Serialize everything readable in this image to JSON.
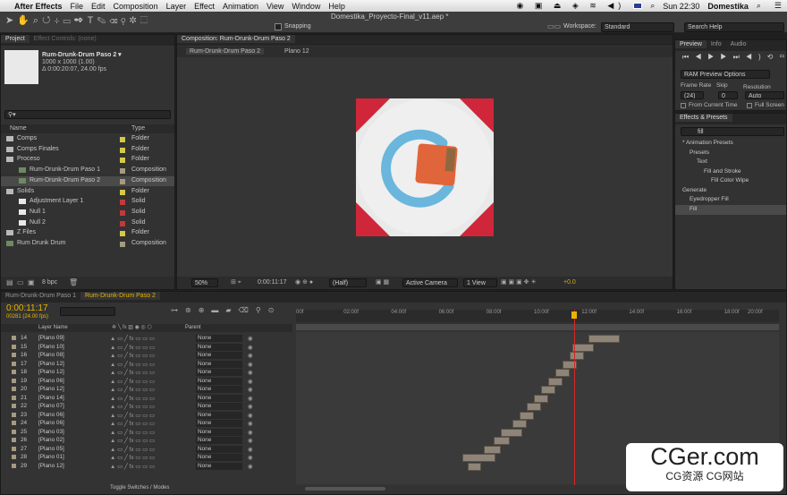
{
  "menubar": {
    "app": "After Effects",
    "items": [
      "File",
      "Edit",
      "Composition",
      "Layer",
      "Effect",
      "Animation",
      "View",
      "Window",
      "Help"
    ],
    "lang": "U.S.",
    "clock": "Sun 22:30",
    "user": "Domestika"
  },
  "window": {
    "title": "Domestika_Proyecto-Final_v11.aep *"
  },
  "toolbar": {
    "snapping": "Snapping",
    "workspace_label": "Workspace:",
    "workspace": "Standard",
    "search": "Search Help"
  },
  "project": {
    "tab": "Project",
    "tab2": "Effect Controls: (none)",
    "comp_name": "Rum-Drunk-Drum Paso 2 ▾",
    "comp_size": "1000 x 1000 (1.00)",
    "comp_dur": "Δ 0:00:20:07, 24.00 fps",
    "search": "⚲▾",
    "col_name": "Name",
    "col_type": "Type",
    "bpc": "8 bpc",
    "items": [
      {
        "name": "Comps",
        "type": "Folder",
        "color": "#d6c94a",
        "indent": 0,
        "kind": "folder"
      },
      {
        "name": "Comps Finales",
        "type": "Folder",
        "color": "#d6c94a",
        "indent": 0,
        "kind": "folder"
      },
      {
        "name": "Proceso",
        "type": "Folder",
        "color": "#d6c94a",
        "indent": 0,
        "kind": "folder"
      },
      {
        "name": "Rum-Drunk-Drum Paso 1",
        "type": "Composition",
        "color": "#a69a82",
        "indent": 1,
        "kind": "comp"
      },
      {
        "name": "Rum-Drunk-Drum Paso 2",
        "type": "Composition",
        "color": "#a69a82",
        "indent": 1,
        "kind": "comp",
        "selected": true
      },
      {
        "name": "Solids",
        "type": "Folder",
        "color": "#d6c94a",
        "indent": 0,
        "kind": "folder"
      },
      {
        "name": "Adjustment Layer 1",
        "type": "Solid",
        "color": "#c23a3a",
        "indent": 1,
        "kind": "solid"
      },
      {
        "name": "Null 1",
        "type": "Solid",
        "color": "#c23a3a",
        "indent": 1,
        "kind": "solid"
      },
      {
        "name": "Null 2",
        "type": "Solid",
        "color": "#c23a3a",
        "indent": 1,
        "kind": "solid"
      },
      {
        "name": "Z Files",
        "type": "Folder",
        "color": "#d6c94a",
        "indent": 0,
        "kind": "folder"
      },
      {
        "name": "Rum Drunk Drum",
        "type": "Composition",
        "color": "#a69a82",
        "indent": 0,
        "kind": "comp"
      }
    ]
  },
  "composition": {
    "tab": "Composition: Rum-Drunk-Drum Paso 2",
    "crumb1": "Rum-Drunk-Drum Paso 2",
    "crumb2": "Plano 12",
    "zoom": "50%",
    "time": "0:00:11:17",
    "resolution": "(Half)",
    "camera": "Active Camera",
    "views": "1 View",
    "exposure": "+0.0"
  },
  "preview": {
    "tab": "Preview",
    "tab2": "Info",
    "tab3": "Audio",
    "ram_options": "RAM Preview Options",
    "frame_rate_label": "Frame Rate",
    "skip_label": "Skip",
    "resolution_label": "Resolution",
    "frame_rate": "(24)",
    "skip": "0",
    "resolution": "Auto",
    "from_current": "From Current Time",
    "full_screen": "Full Screen"
  },
  "effects": {
    "tab": "Effects & Presets",
    "search": "fill",
    "tree": [
      {
        "label": "* Animation Presets",
        "indent": 0
      },
      {
        "label": "Presets",
        "indent": 1
      },
      {
        "label": "Text",
        "indent": 2
      },
      {
        "label": "Fill and Stroke",
        "indent": 3
      },
      {
        "label": "Fill Color Wipe",
        "indent": 4
      },
      {
        "label": "Generate",
        "indent": 0
      },
      {
        "label": "Eyedropper Fill",
        "indent": 1
      },
      {
        "label": "Fill",
        "indent": 1,
        "selected": true
      }
    ]
  },
  "timeline": {
    "tabs": [
      "Rum-Drunk-Drum Paso 1",
      "Rum-Drunk-Drum Paso 2"
    ],
    "time": "0:00:11:17",
    "frames": "00281 (24.00 fps)",
    "col_layer": "Layer Name",
    "col_parent": "Parent",
    "toggle": "Toggle Switches / Modes",
    "ruler": [
      "00f",
      "02:00f",
      "04:00f",
      "06:00f",
      "08:00f",
      "10:00f",
      "12:00f",
      "14:00f",
      "16:00f",
      "18:00f",
      "20:00f"
    ],
    "layers": [
      {
        "num": "14",
        "name": "[Plano 09]",
        "parent": "None",
        "start": 12.3,
        "end": 13.6
      },
      {
        "num": "15",
        "name": "[Plano 10]",
        "parent": "None",
        "start": 11.6,
        "end": 12.5
      },
      {
        "num": "16",
        "name": "[Plano 08]",
        "parent": "None",
        "start": 11.5,
        "end": 12.1
      },
      {
        "num": "17",
        "name": "[Plano 12]",
        "parent": "None",
        "start": 11.2,
        "end": 11.8
      },
      {
        "num": "18",
        "name": "[Plano 12]",
        "parent": "None",
        "start": 10.9,
        "end": 11.5
      },
      {
        "num": "19",
        "name": "[Plano 06]",
        "parent": "None",
        "start": 10.6,
        "end": 11.2
      },
      {
        "num": "20",
        "name": "[Plano 12]",
        "parent": "None",
        "start": 10.3,
        "end": 10.9
      },
      {
        "num": "21",
        "name": "[Plano 14]",
        "parent": "None",
        "start": 10.0,
        "end": 10.6
      },
      {
        "num": "22",
        "name": "[Plano 07]",
        "parent": "None",
        "start": 9.7,
        "end": 10.3
      },
      {
        "num": "23",
        "name": "[Plano 06]",
        "parent": "None",
        "start": 9.4,
        "end": 10.0
      },
      {
        "num": "24",
        "name": "[Plano 06]",
        "parent": "None",
        "start": 9.1,
        "end": 9.7
      },
      {
        "num": "25",
        "name": "[Plano 03]",
        "parent": "None",
        "start": 8.6,
        "end": 9.5
      },
      {
        "num": "26",
        "name": "[Plano 02]",
        "parent": "None",
        "start": 8.3,
        "end": 9.0
      },
      {
        "num": "27",
        "name": "[Plano 05]",
        "parent": "None",
        "start": 7.9,
        "end": 8.6
      },
      {
        "num": "28",
        "name": "[Plano 01]",
        "parent": "None",
        "start": 7.0,
        "end": 8.4
      },
      {
        "num": "29",
        "name": "[Plano 12]",
        "parent": "None",
        "start": 7.2,
        "end": 7.8
      }
    ]
  },
  "watermark": {
    "big": "CGer.com",
    "small": "CG资源 CG网站"
  },
  "colors": {
    "accent": "#e8b400",
    "playhead": "#d62828",
    "comp_bg": "#e9e9e9",
    "ring": "#6ab6dc",
    "square": "#e0653a",
    "corners": "#d0263a"
  }
}
